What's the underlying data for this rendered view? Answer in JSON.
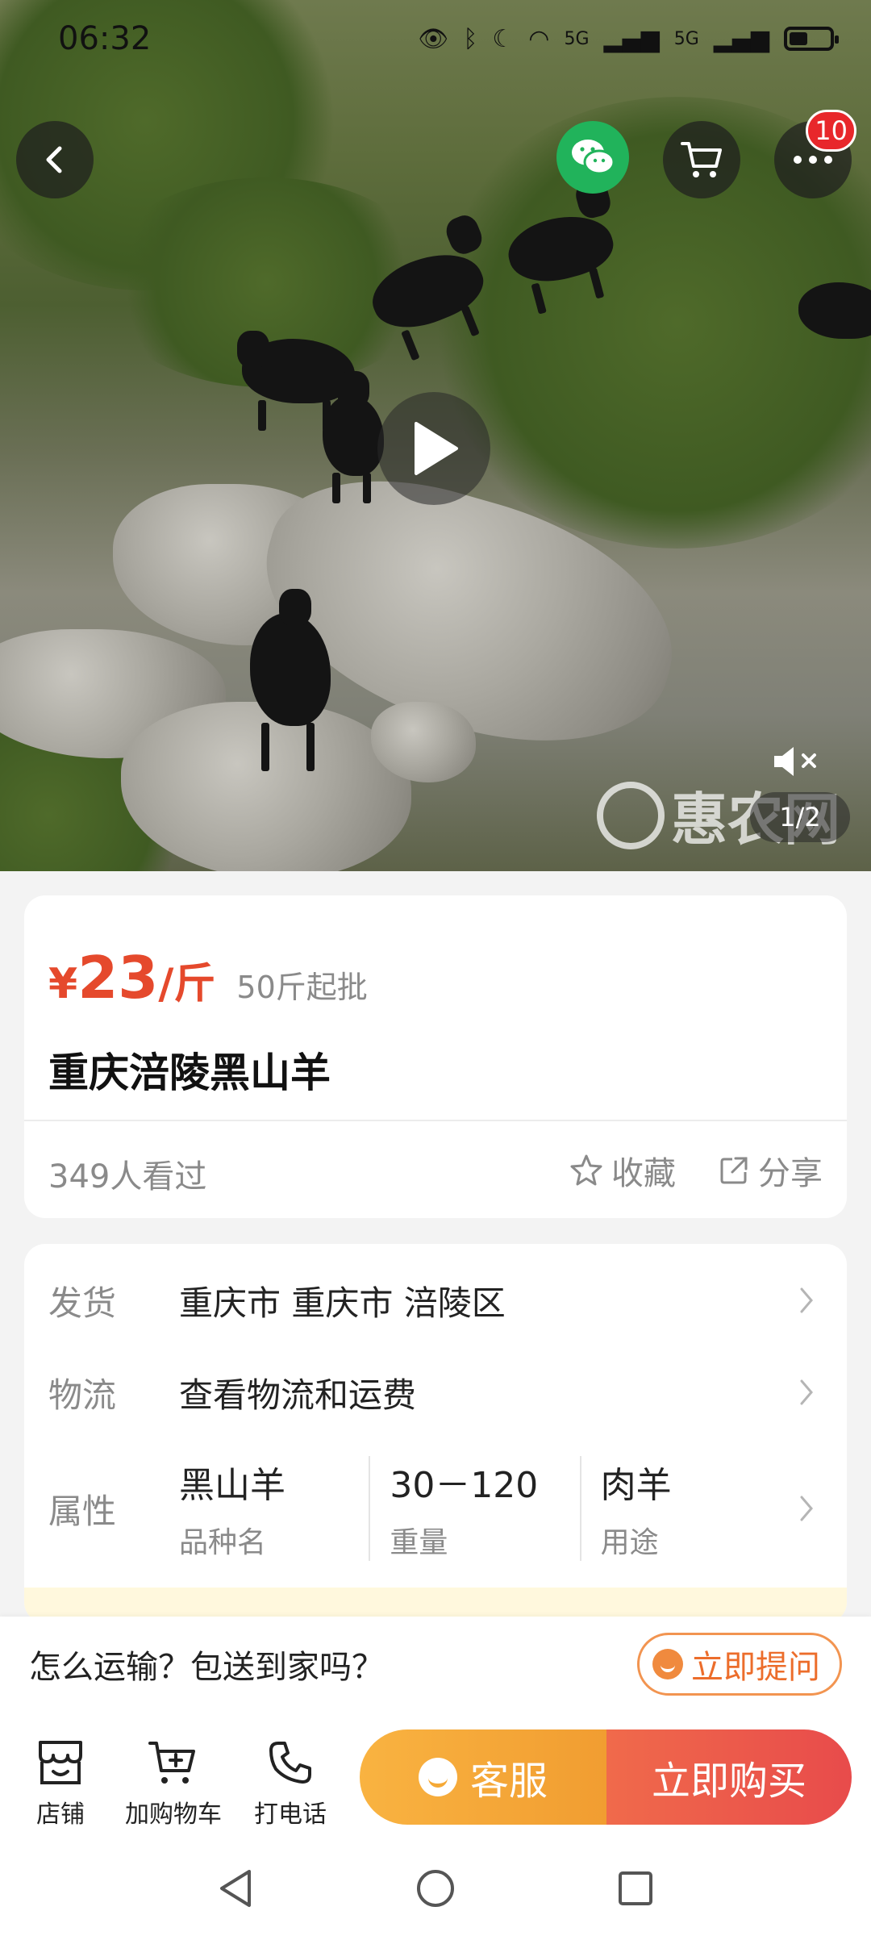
{
  "status_bar": {
    "time": "06:32",
    "network_1": "5G",
    "network_2": "5G"
  },
  "media": {
    "counter": "1/2",
    "watermark": "惠农网",
    "cart_badge": "10"
  },
  "product": {
    "price_symbol": "¥",
    "price_value": "23",
    "price_unit": "/斤",
    "min_order": "50斤起批",
    "title": "重庆涪陵黑山羊",
    "views": "349人看过",
    "favorite_label": "收藏",
    "share_label": "分享"
  },
  "info": {
    "ship_label": "发货",
    "ship_value": "重庆市 重庆市 涪陵区",
    "logistics_label": "物流",
    "logistics_value": "查看物流和运费",
    "attr_label": "属性",
    "attributes": [
      {
        "value": "黑山羊",
        "name": "品种名"
      },
      {
        "value": "30－120",
        "name": "重量"
      },
      {
        "value": "肉羊",
        "name": "用途"
      }
    ]
  },
  "question": {
    "text": "怎么运输？包送到家吗？",
    "ask_button": "立即提问"
  },
  "bottom_bar": {
    "store": "店铺",
    "add_cart": "加购物车",
    "call": "打电话",
    "service": "客服",
    "buy_now": "立即购买"
  }
}
